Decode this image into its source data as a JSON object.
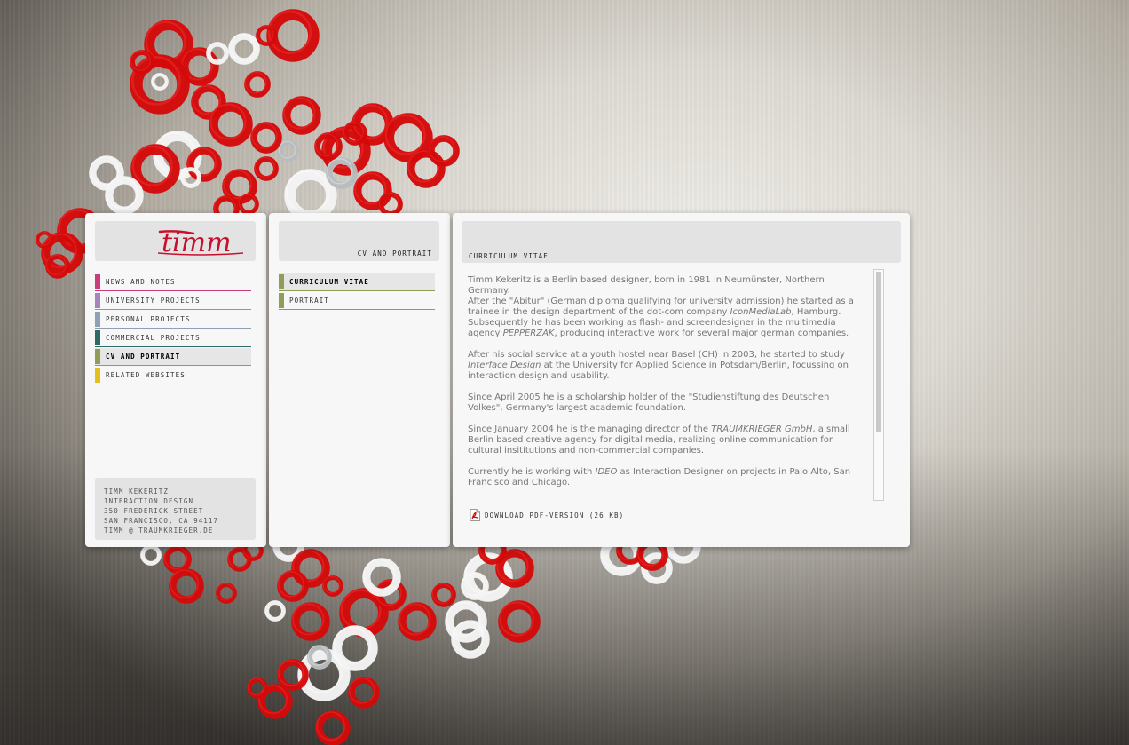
{
  "colors": {
    "ring_red": "#d40a0a",
    "ring_white": "#f4f4f4",
    "ring_grey": "#b7bcbf",
    "logo_red": "#c8102e",
    "nav_news": "#c83d7a",
    "nav_university": "#a585bf",
    "nav_personal": "#8fa0b5",
    "nav_commercial": "#2c6b66",
    "nav_cv": "#8e9e55",
    "nav_related": "#e5bf1e"
  },
  "logo": {
    "text": "timm"
  },
  "nav": {
    "items": [
      {
        "label": "news and notes",
        "color": "#c83d7a"
      },
      {
        "label": "university projects",
        "color": "#a585bf"
      },
      {
        "label": "personal projects",
        "color": "#8fa0b5"
      },
      {
        "label": "commercial projects",
        "color": "#2c6b66"
      },
      {
        "label": "cv and portrait",
        "color": "#8e9e55",
        "active": true
      },
      {
        "label": "related websites",
        "color": "#e5bf1e"
      }
    ]
  },
  "address": {
    "name": "timm kekeritz",
    "field": "interaction design",
    "street": "350 frederick street",
    "city": "san francisco, ca 94117",
    "email": "timm @ traumkrieger.de"
  },
  "section": {
    "title": "cv and portrait",
    "items": [
      {
        "label": "curriculum vitae",
        "color": "#8e9e55",
        "active": true
      },
      {
        "label": "portrait",
        "color": "#8e9e55"
      }
    ]
  },
  "content": {
    "title": "curriculum vitae",
    "p1a": "Timm Kekeritz is a Berlin based designer, born in 1981 in Neumünster, Northern Germany.",
    "p1b_1": "After the \"Abitur\" (German diploma qualifying for university admission) he started as a trainee in the design department of the dot-com company ",
    "p1b_em": "IconMediaLab",
    "p1b_2": ", Hamburg. Subsequently he has been working as flash- and screendesigner in the multimedia agency ",
    "p1b_em2": "PEPPERZAK",
    "p1b_3": ", producing interactive work for several major german companies.",
    "p2_1": "After his social service at a youth hostel near Basel (CH) in 2003, he started to study ",
    "p2_em": "Interface Design",
    "p2_2": " at the University for Applied Science in Potsdam/Berlin, focussing on interaction design and usability.",
    "p3": "Since April 2005 he is a scholarship holder of the \"Studienstiftung des Deutschen Volkes\", Germany's largest academic foundation.",
    "p4_1": "Since January 2004 he is the managing director of the ",
    "p4_em": "TRAUMKRIEGER GmbH",
    "p4_2": ", a small Berlin based creative agency for digital media, realizing online communication for cultural insititutions and non-commercial companies.",
    "p5_1": "Currently he is working with ",
    "p5_em": "IDEO",
    "p5_2": " as Interaction Designer on projects in Palo Alto, San Francisco and Chicago.",
    "download": "download pdf-version (26 kb)",
    "download_icon": "pdf-icon"
  }
}
